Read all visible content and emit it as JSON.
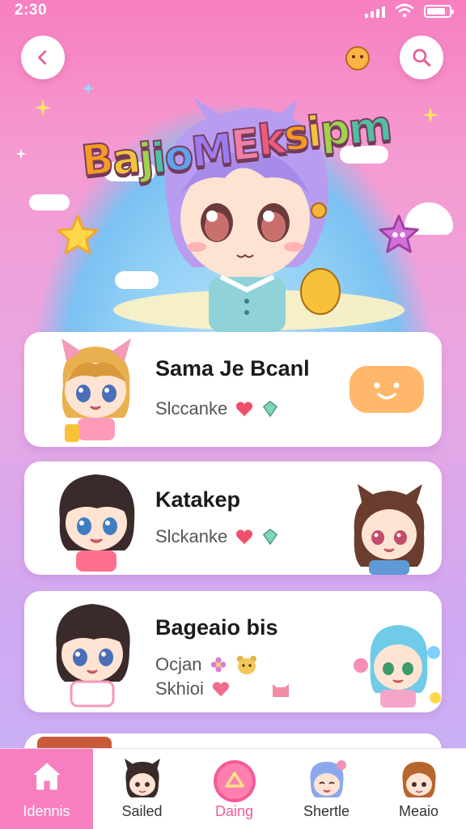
{
  "status": {
    "time": "2:30"
  },
  "hero": {
    "title": "BajioMEksipm",
    "title_colors": [
      "#f59a23",
      "#f3c43a",
      "#9fd34a",
      "#4fc0a0",
      "#5fa3f0",
      "#9b7cf0",
      "#f07fa7",
      "#ef5b7a"
    ]
  },
  "cards": [
    {
      "title": "Sama Je Bcanl",
      "subtitle": "Slccanke",
      "badge_icon": "smile-face-icon"
    },
    {
      "title": "Katakep",
      "subtitle": "Slckanke"
    },
    {
      "title": "Bageaio bis",
      "subtitle": "Ocjan",
      "subtitle2": "Skhioi"
    }
  ],
  "nav": [
    {
      "label": "Idennis",
      "icon": "home-icon",
      "active": true
    },
    {
      "label": "Sailed",
      "icon": "avatar-icon"
    },
    {
      "label": "Daing",
      "icon": "triangle-icon"
    },
    {
      "label": "Shertle",
      "icon": "avatar-icon"
    },
    {
      "label": "Meaio",
      "icon": "avatar-icon"
    }
  ],
  "colors": {
    "accent": "#f77fbf",
    "card_bg": "#ffffff",
    "bubble_orange": "#ffb86b"
  }
}
